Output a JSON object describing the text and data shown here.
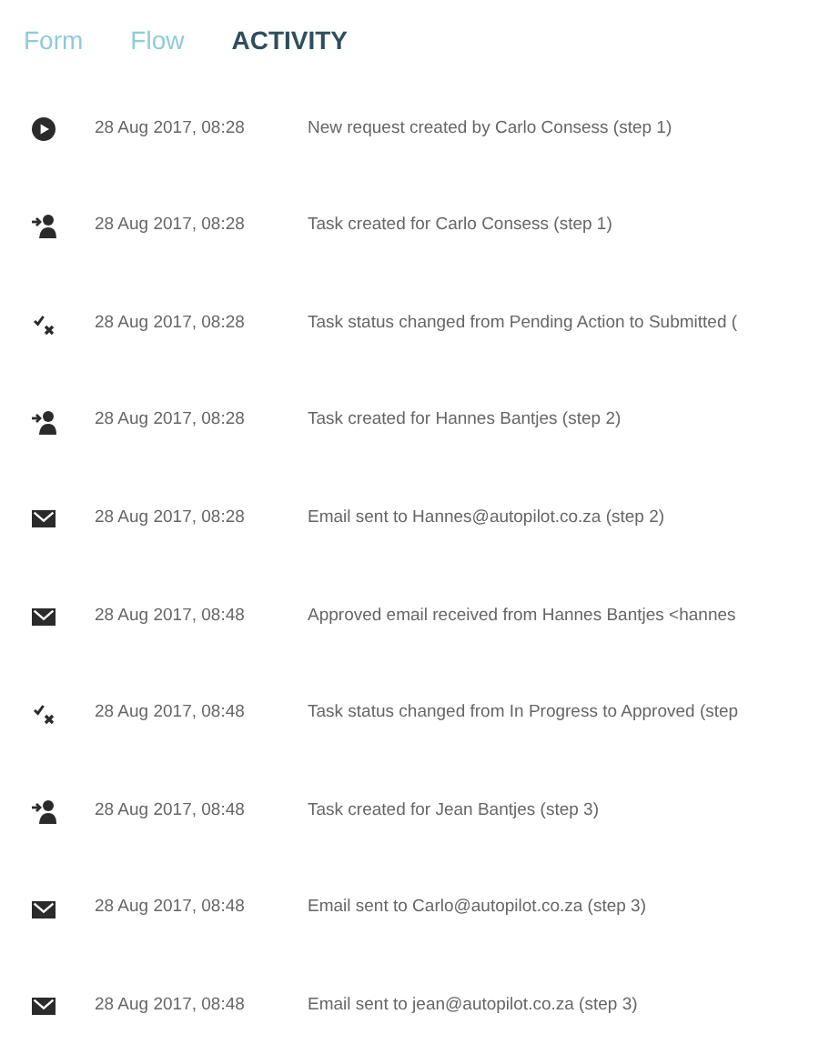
{
  "tabs": [
    {
      "label": "Form",
      "selected": false
    },
    {
      "label": "Flow",
      "selected": false
    },
    {
      "label": "ACTIVITY",
      "selected": true
    }
  ],
  "activity": [
    {
      "kind": "start",
      "time": "28 Aug 2017, 08:28",
      "message": "New request created by Carlo Consess (step 1)"
    },
    {
      "kind": "task",
      "time": "28 Aug 2017, 08:28",
      "message": "Task created for Carlo Consess (step 1)"
    },
    {
      "kind": "status",
      "time": "28 Aug 2017, 08:28",
      "message": "Task status changed from Pending Action to Submitted ("
    },
    {
      "kind": "task",
      "time": "28 Aug 2017, 08:28",
      "message": "Task created for Hannes Bantjes (step 2)"
    },
    {
      "kind": "email",
      "time": "28 Aug 2017, 08:28",
      "message": "Email sent to Hannes@autopilot.co.za (step 2)"
    },
    {
      "kind": "email",
      "time": "28 Aug 2017, 08:48",
      "message": "Approved email received from Hannes Bantjes <hannes"
    },
    {
      "kind": "status",
      "time": "28 Aug 2017, 08:48",
      "message": "Task status changed from In Progress to Approved (step"
    },
    {
      "kind": "task",
      "time": "28 Aug 2017, 08:48",
      "message": "Task created for Jean Bantjes (step 3)"
    },
    {
      "kind": "email",
      "time": "28 Aug 2017, 08:48",
      "message": "Email sent to Carlo@autopilot.co.za (step 3)"
    },
    {
      "kind": "email",
      "time": "28 Aug 2017, 08:48",
      "message": "Email sent to jean@autopilot.co.za (step 3)"
    }
  ]
}
